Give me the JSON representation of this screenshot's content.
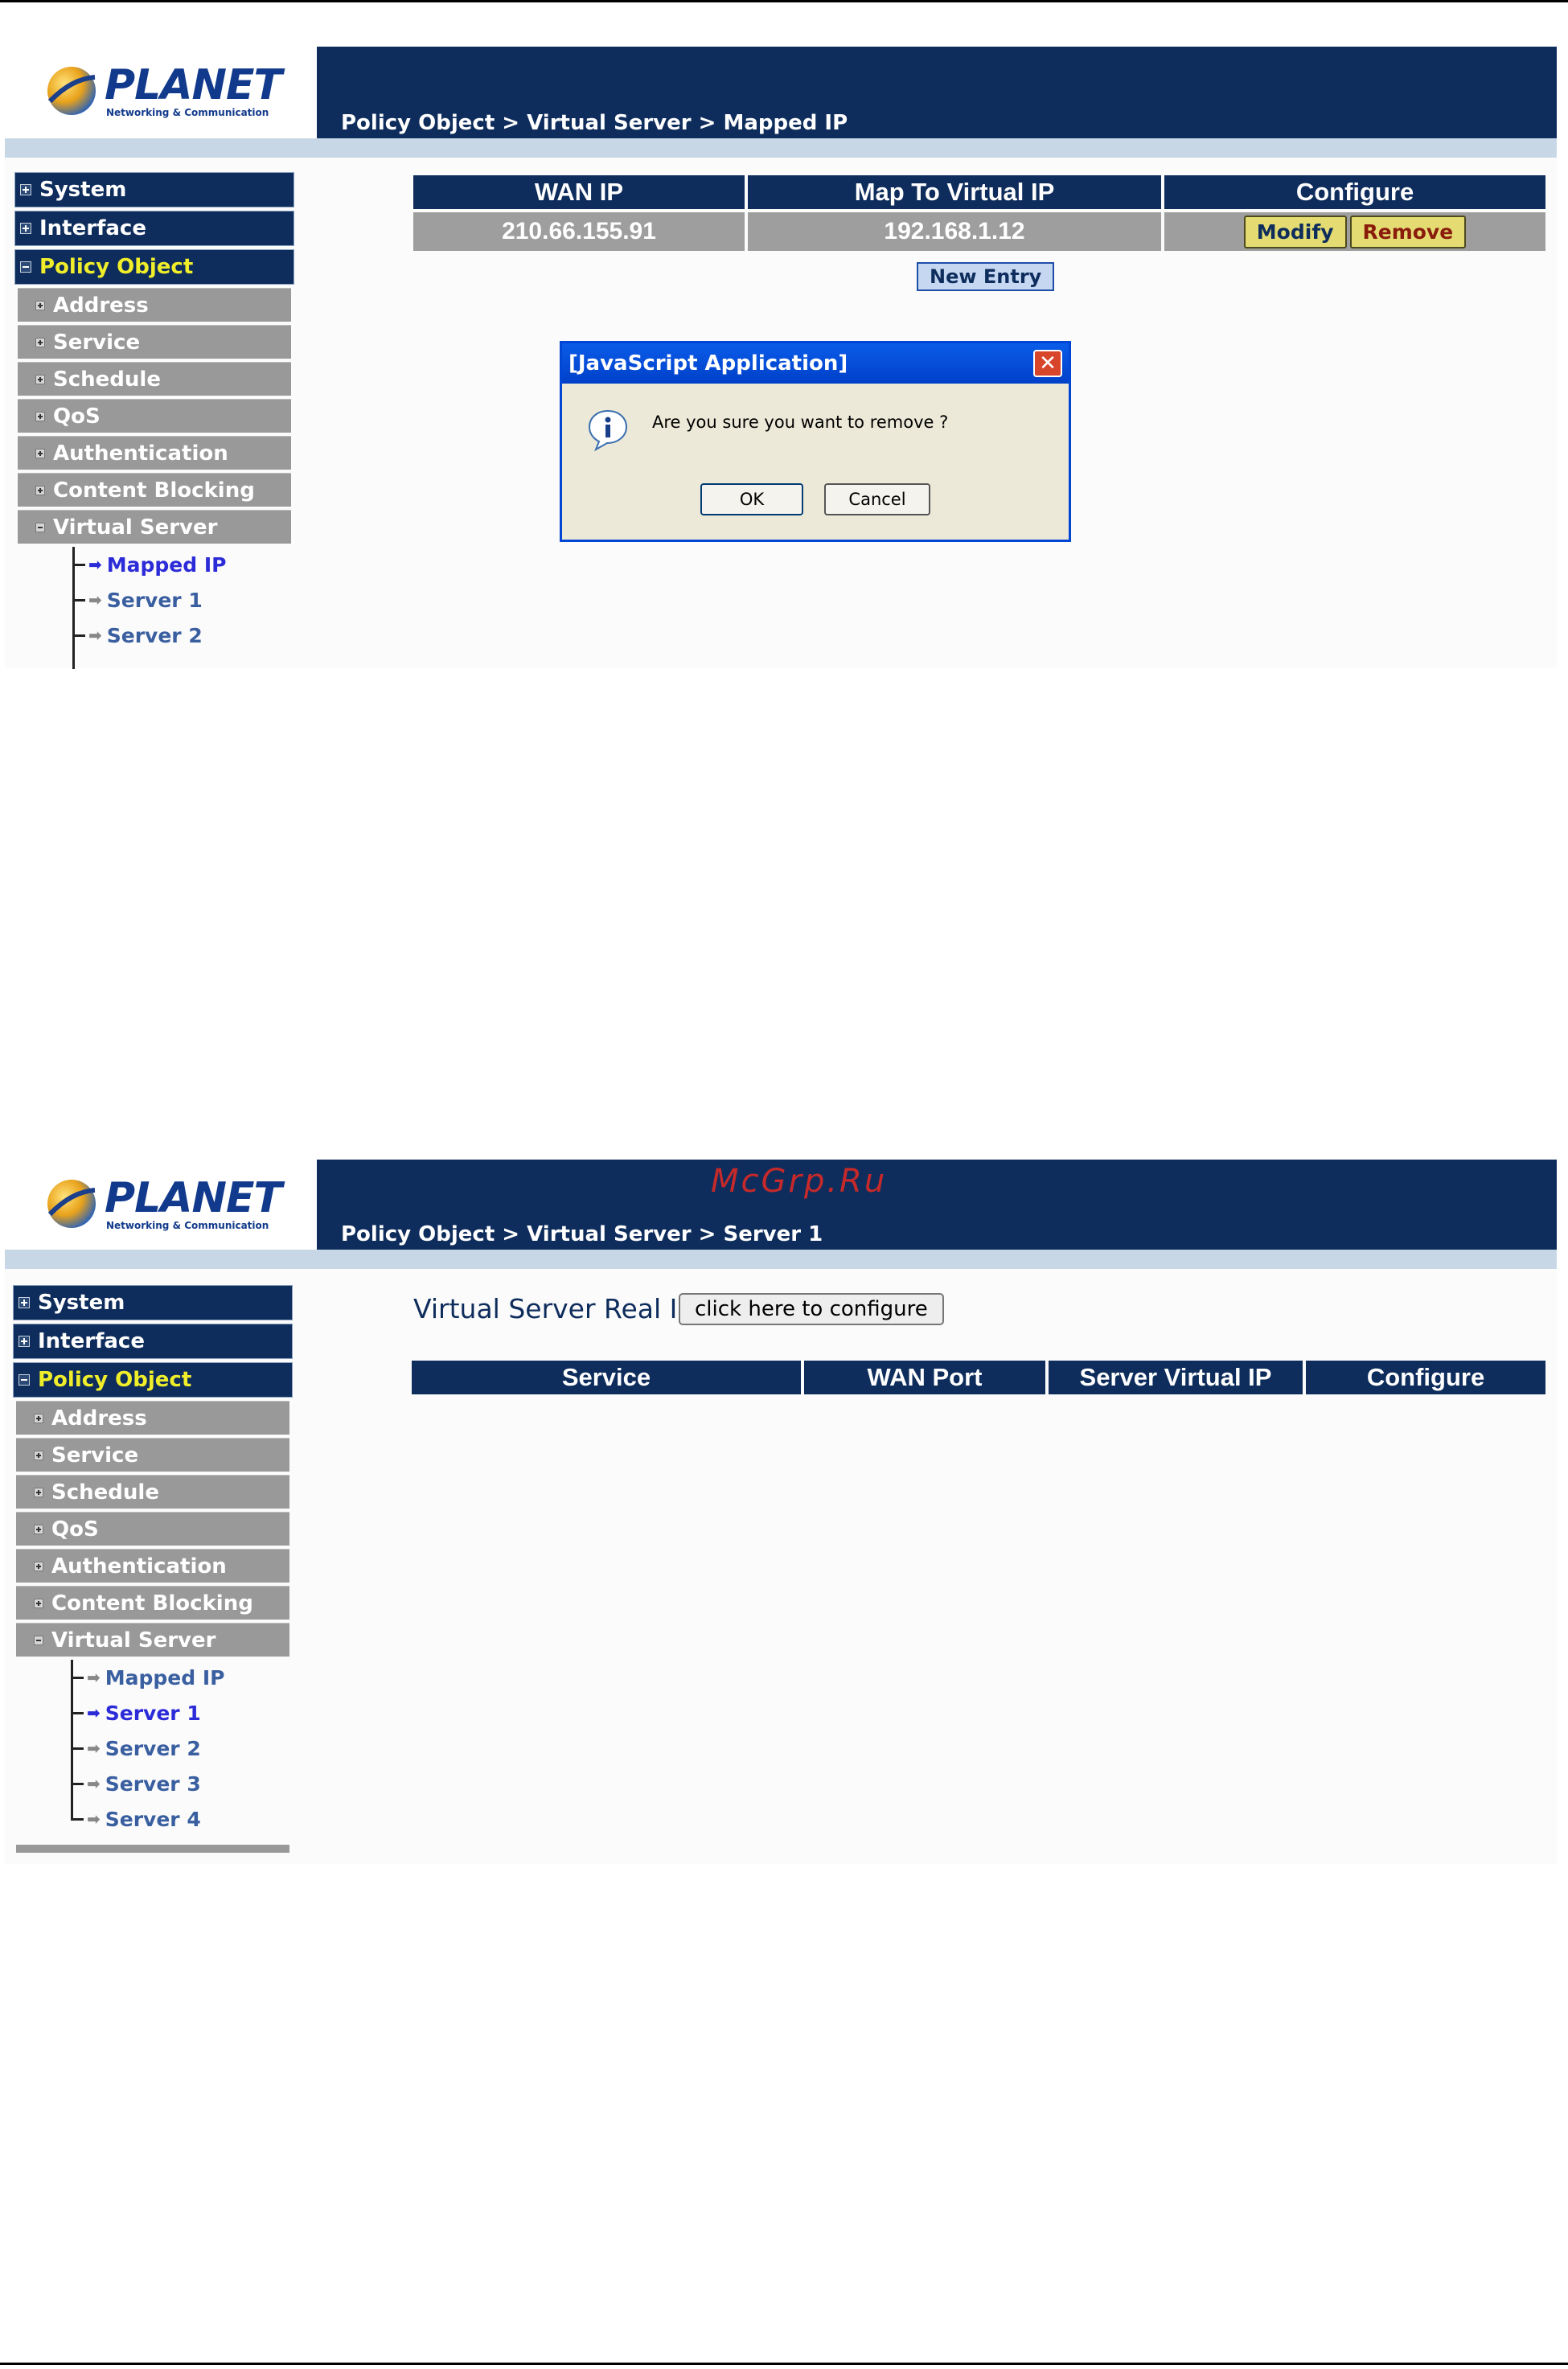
{
  "brand": {
    "name": "PLANET",
    "tagline": "Networking & Communication",
    "color": "#0e2d5c"
  },
  "watermark": "McGrp.Ru",
  "sidebar_main": [
    "System",
    "Interface",
    "Policy Object"
  ],
  "sidebar_sub": [
    "Address",
    "Service",
    "Schedule",
    "QoS",
    "Authentication",
    "Content Blocking",
    "Virtual Server"
  ],
  "screen1": {
    "breadcrumb": "Policy Object > Virtual Server > Mapped IP",
    "tree": [
      "Mapped IP",
      "Server 1",
      "Server 2"
    ],
    "table": {
      "headers": [
        "WAN IP",
        "Map To Virtual IP",
        "Configure"
      ],
      "rows": [
        {
          "wan_ip": "210.66.155.91",
          "virtual_ip": "192.168.1.12"
        }
      ],
      "modify_label": "Modify",
      "remove_label": "Remove"
    },
    "new_entry_label": "New Entry",
    "dialog": {
      "title": "[JavaScript Application]",
      "message": "Are you sure you want to remove ?",
      "ok_label": "OK",
      "cancel_label": "Cancel"
    }
  },
  "screen2": {
    "breadcrumb": "Policy Object > Virtual Server > Server 1",
    "tree": [
      "Mapped IP",
      "Server 1",
      "Server 2",
      "Server 3",
      "Server 4"
    ],
    "real_ip_label": "Virtual Server Real IP",
    "configure_button": "click here to configure",
    "table_headers": [
      "Service",
      "WAN Port",
      "Server Virtual IP",
      "Configure"
    ]
  }
}
